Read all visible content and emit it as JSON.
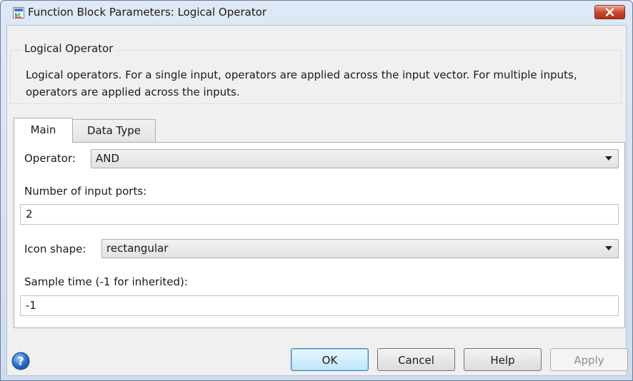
{
  "window": {
    "title": "Function Block Parameters: Logical Operator"
  },
  "block": {
    "group_title": "Logical Operator",
    "description": "Logical operators.  For a single input, operators are applied across the input vector.  For multiple inputs, operators are applied across the inputs."
  },
  "tabs": [
    {
      "label": "Main",
      "selected": true
    },
    {
      "label": "Data Type",
      "selected": false
    }
  ],
  "main": {
    "operator_label": "Operator:",
    "operator_value": "AND",
    "num_ports_label": "Number of input ports:",
    "num_ports_value": "2",
    "icon_shape_label": "Icon shape:",
    "icon_shape_value": "rectangular",
    "sample_time_label": "Sample time (-1 for inherited):",
    "sample_time_value": "-1"
  },
  "buttons": {
    "ok": "OK",
    "cancel": "Cancel",
    "help": "Help",
    "apply": "Apply"
  },
  "icons": {
    "app": "block-parameters-icon",
    "close": "close-icon",
    "help": "help-question-icon"
  },
  "colors": {
    "close_button": "#c8442b",
    "help_icon": "#2a6fc9",
    "ok_border": "#3c7fb1"
  }
}
